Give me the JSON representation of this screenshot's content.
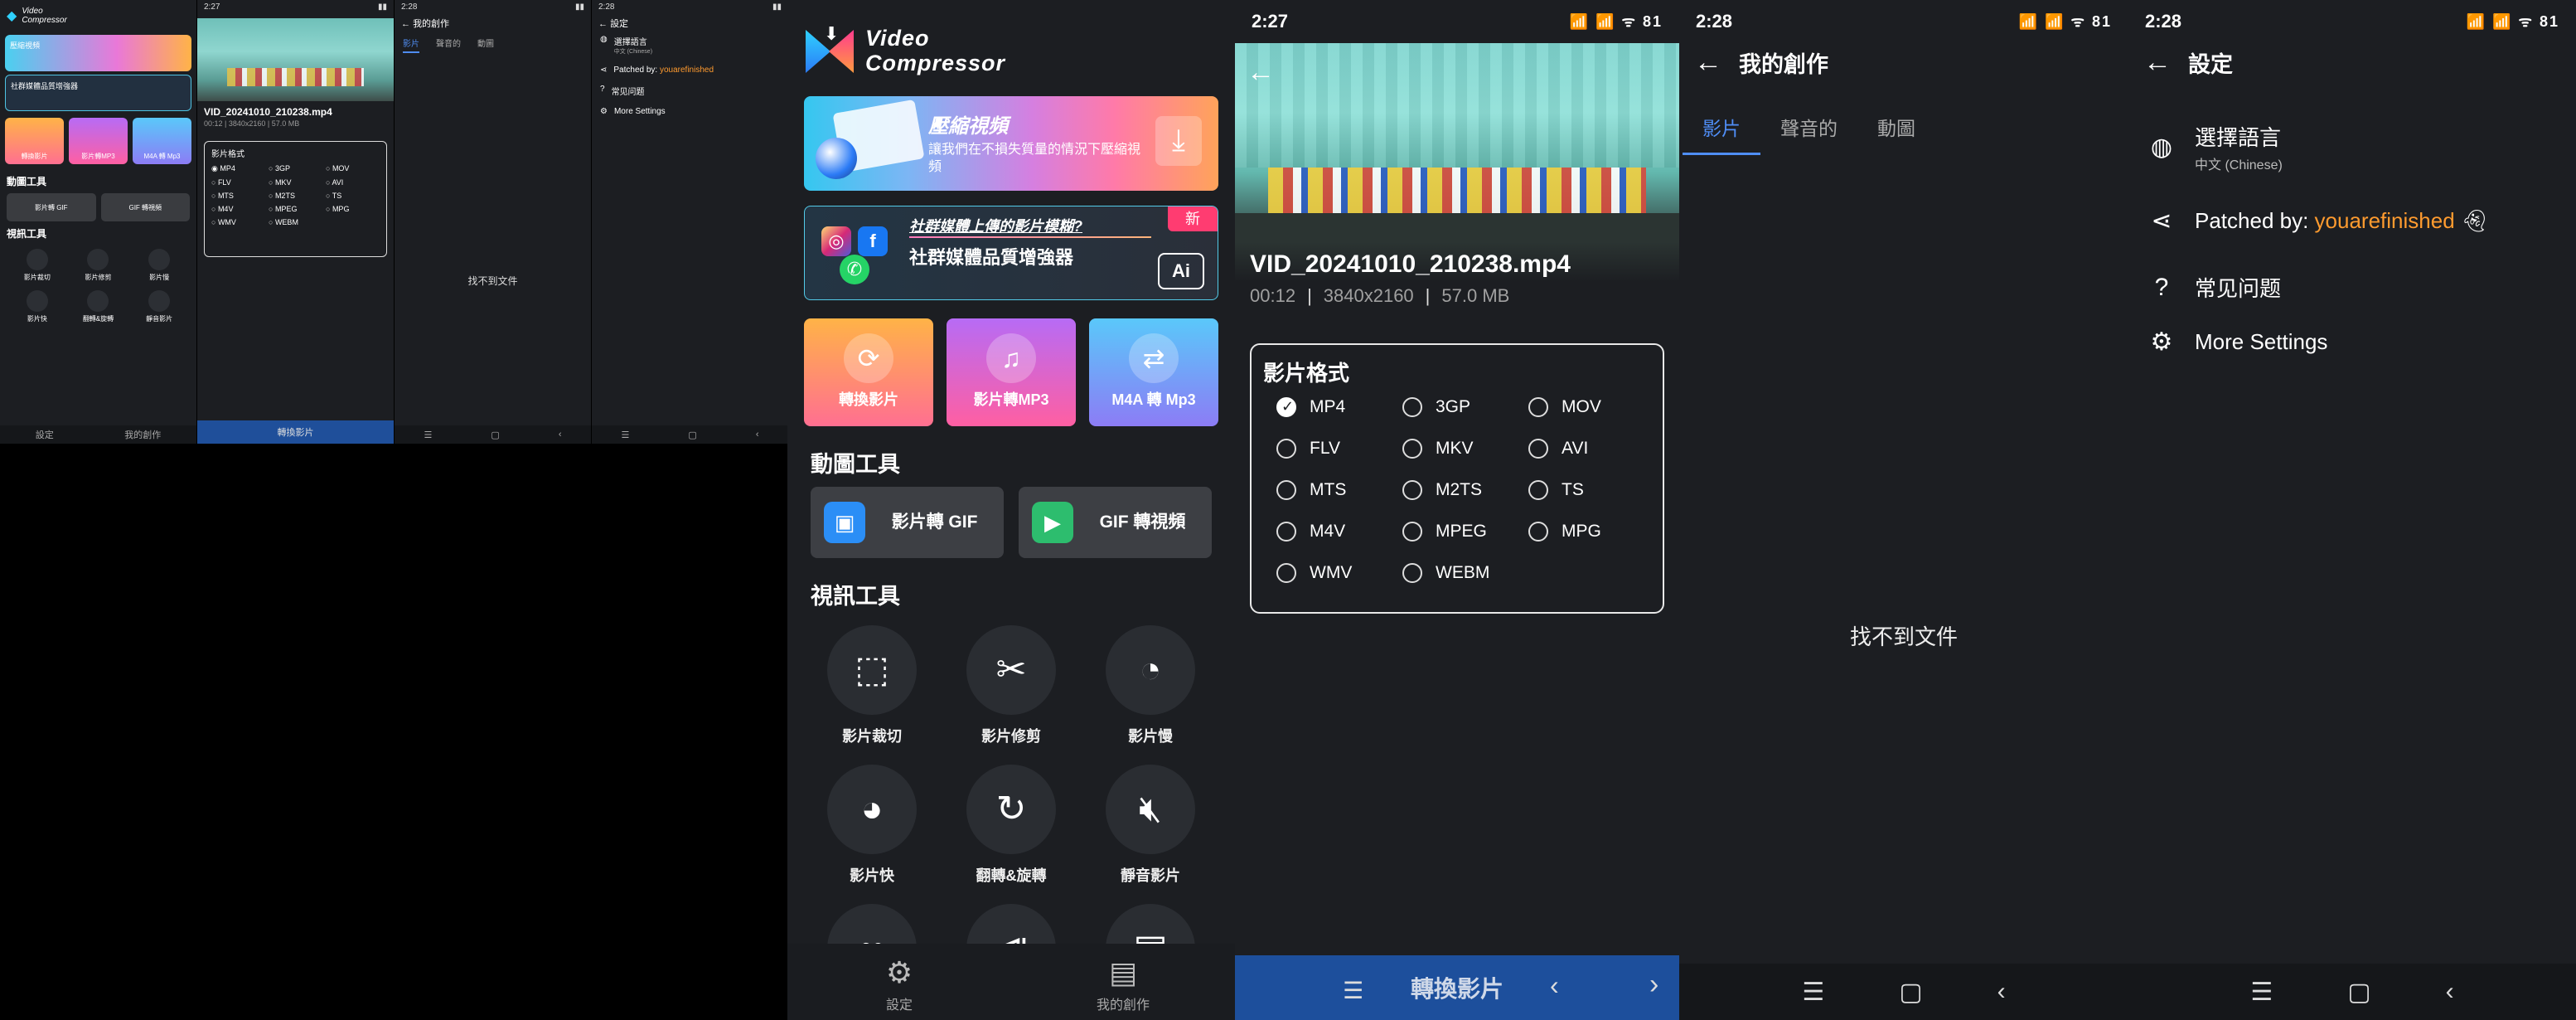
{
  "status": {
    "time_convert": "2:27",
    "time_works": "2:28",
    "time_settings": "2:28",
    "icons": "📶 📶 ᯤ 81"
  },
  "home": {
    "logo_line1": "Video",
    "logo_line2": "Compressor",
    "banner1_title": "壓縮視頻",
    "banner1_text": "讓我們在不損失質量的情況下壓縮視頻",
    "banner2_question": "社群媒體上傳的影片模糊?",
    "banner2_title": "社群媒體品質增強器",
    "banner2_badge": "新",
    "banner2_ai": "Ai",
    "cards": [
      {
        "label": "轉換影片",
        "icon": "convert-icon",
        "bg": "linear-gradient(180deg,#ffb347,#ff6f91)"
      },
      {
        "label": "影片轉MP3",
        "icon": "music-video-icon",
        "bg": "linear-gradient(180deg,#b76bf5,#ff5fa2)"
      },
      {
        "label": "M4A 轉 Mp3",
        "icon": "file-convert-icon",
        "bg": "linear-gradient(180deg,#5ac8fa,#8c7cf5)"
      }
    ],
    "gif_section": "動圖工具",
    "gif_tools": [
      {
        "label": "影片轉 GIF",
        "icon": "video-to-gif-icon",
        "color": "#2b8ef6"
      },
      {
        "label": "GIF 轉視頻",
        "icon": "gif-to-video-icon",
        "color": "#2dbd6e"
      }
    ],
    "video_section": "視訊工具",
    "video_tools": [
      {
        "label": "影片裁切",
        "icon": "crop-icon"
      },
      {
        "label": "影片修剪",
        "icon": "trim-icon"
      },
      {
        "label": "影片慢",
        "icon": "slow-motion-icon"
      },
      {
        "label": "影片快",
        "icon": "fast-motion-icon"
      },
      {
        "label": "翻轉&旋轉",
        "icon": "rotate-icon"
      },
      {
        "label": "靜音影片",
        "icon": "mute-icon"
      },
      {
        "label": "",
        "icon": "loop-icon"
      },
      {
        "label": "",
        "icon": "reverse-icon"
      },
      {
        "label": "",
        "icon": "video-editor-icon"
      }
    ],
    "nav_settings": "設定",
    "nav_works": "我的創作"
  },
  "convert": {
    "filename": "VID_20241010_210238.mp4",
    "duration": "00:12",
    "resolution": "3840x2160",
    "size": "57.0 MB",
    "format_title": "影片格式",
    "formats": [
      "MP4",
      "3GP",
      "MOV",
      "FLV",
      "MKV",
      "AVI",
      "MTS",
      "M2TS",
      "TS",
      "M4V",
      "MPEG",
      "MPG",
      "WMV",
      "WEBM"
    ],
    "selected": "MP4",
    "action_label": "轉換影片"
  },
  "works": {
    "title": "我的創作",
    "tabs": [
      "影片",
      "聲音的",
      "動圖"
    ],
    "active_tab": "影片",
    "empty": "找不到文件"
  },
  "settings": {
    "title": "設定",
    "language_label": "選擇語言",
    "language_value": "中文 (Chinese)",
    "patched_prefix": "Patched by: ",
    "patched_name": "youarefinished",
    "faq": "常见问题",
    "more": "More Settings"
  }
}
